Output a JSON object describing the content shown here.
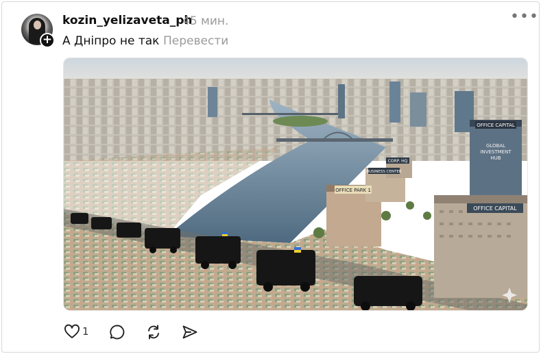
{
  "post": {
    "username": "kozin_yelizaveta_ph",
    "timestamp": "45 мин.",
    "text": "А Дніпро не так",
    "translate_label": "Перевести",
    "more_icon": "more-horizontal-icon"
  },
  "image": {
    "signs": {
      "office_capital_top": "OFFICE CAPITAL",
      "global_hub_line1": "GLOBAL",
      "global_hub_line2": "INVESTMENT",
      "global_hub_line3": "HUB",
      "corp_hq": "CORP. HQ",
      "business_center": "BUSINESS CENTER",
      "office_park": "OFFICE PARK 1",
      "office_capital_bottom": "OFFICE CAPITAL"
    }
  },
  "actions": {
    "like_icon": "heart-icon",
    "like_count": "1",
    "comment_icon": "comment-icon",
    "repost_icon": "repost-icon",
    "share_icon": "send-icon"
  },
  "colors": {
    "text_primary": "#111111",
    "text_secondary": "#9a9a9a",
    "border": "#d8d8d8"
  }
}
